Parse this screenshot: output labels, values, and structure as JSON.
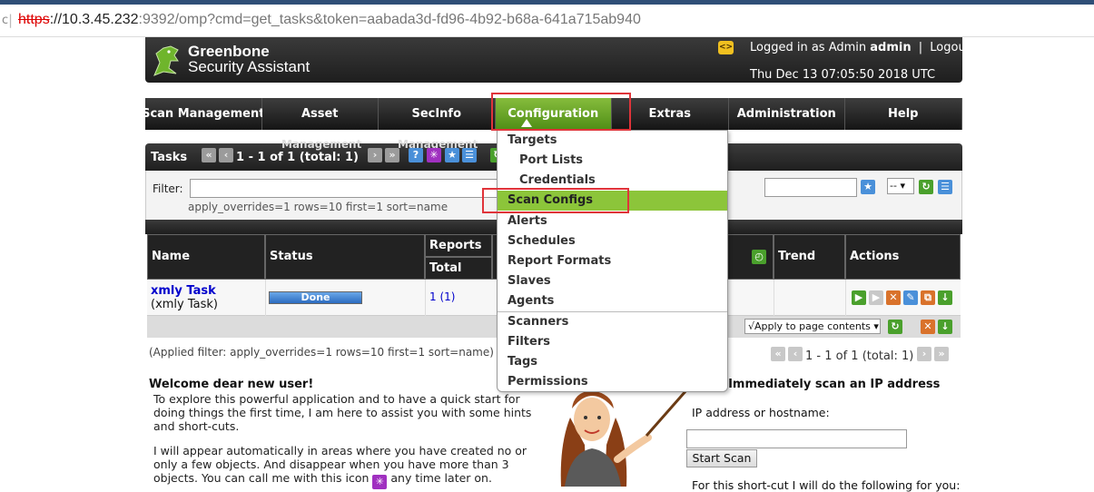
{
  "browser": {
    "url_scheme": "https",
    "url_host": "://10.3.45.232",
    "url_rest": ":9392/omp?cmd=get_tasks&token=aabada3d-fd96-4b92-b68a-641a715ab940"
  },
  "header": {
    "brand_line1": "Greenbone",
    "brand_line2": "Security Assistant",
    "xml_icon": "<>",
    "logged_in_prefix": "Logged in as Admin",
    "username": "admin",
    "separator": "|",
    "logout": "Logout",
    "datetime": "Thu Dec 13 07:05:50 2018 UTC"
  },
  "nav": {
    "items": [
      "Scan Management",
      "Asset",
      "SecInfo",
      "Configuration",
      "Extras",
      "Administration",
      "Help"
    ],
    "active": "Configuration"
  },
  "tasks": {
    "title": "Tasks",
    "pager": "1 - 1 of 1 (total: 1)",
    "ghost_labels": [
      "Management",
      "Management"
    ],
    "filter_label": "Filter:",
    "filter_value": "",
    "filter_applied": "apply_overrides=1 rows=10 first=1 sort=name",
    "filter_select": "--"
  },
  "table": {
    "headers": {
      "name": "Name",
      "status": "Status",
      "reports": "Reports",
      "total": "Total",
      "trend": "Trend",
      "actions": "Actions"
    },
    "rows": [
      {
        "name": "xmly Task",
        "comment": "(xmly Task)",
        "status": "Done",
        "total": "1",
        "total_detail": "(1)"
      }
    ],
    "apply_select": "√Apply to page contents",
    "applied_filter": "(Applied filter: apply_overrides=1 rows=10 first=1 sort=name)",
    "pager_bottom": "1 - 1 of 1 (total: 1)"
  },
  "welcome": {
    "title": "Welcome dear new user!",
    "p1": "To explore this powerful application and to have a quick start for doing things the first time, I am here to assist you with some hints and short-cuts.",
    "p2_before": "I will appear automatically in areas where you have created no or only a few objects. And disappear when you have more than 3 objects. You can call me with this icon",
    "p2_after": "any time later on."
  },
  "quickstart": {
    "title": "start: Immediately scan an IP address",
    "label": "IP address or hostname:",
    "value": "",
    "button": "Start Scan",
    "note": "For this short-cut I will do the following for you:"
  },
  "dropdown": {
    "items": [
      {
        "label": "Targets",
        "sub": false
      },
      {
        "label": "Port Lists",
        "sub": true
      },
      {
        "label": "Credentials",
        "sub": true
      },
      {
        "label": "Scan Configs",
        "sub": false
      },
      {
        "label": "Alerts",
        "sub": false
      },
      {
        "label": "Schedules",
        "sub": false
      },
      {
        "label": "Report Formats",
        "sub": false
      },
      {
        "label": "Slaves",
        "sub": false
      },
      {
        "label": "Agents",
        "sub": false
      },
      {
        "label": "Scanners",
        "sub": false
      },
      {
        "label": "Filters",
        "sub": false
      },
      {
        "label": "Tags",
        "sub": false
      },
      {
        "label": "Permissions",
        "sub": false
      }
    ],
    "active": "Scan Configs"
  },
  "colors": {
    "nav_active": "#6aa62a",
    "highlight_box": "#e0343a",
    "dropdown_active": "#8cc53a"
  }
}
